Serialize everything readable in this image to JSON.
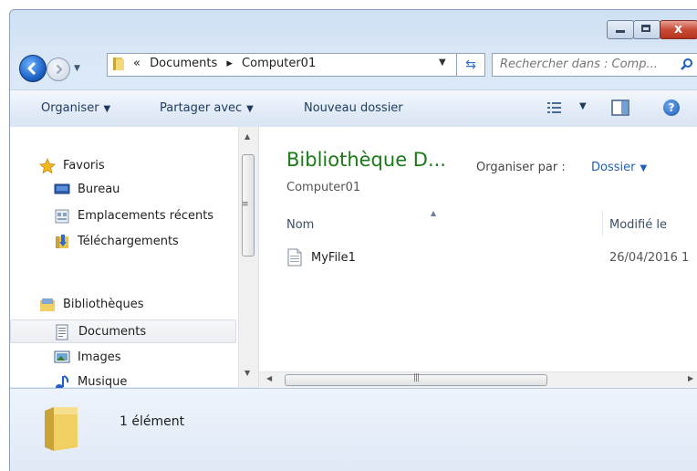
{
  "window": {
    "caption_buttons": {
      "minimize_icon": "minimize-icon",
      "maximize_icon": "maximize-icon",
      "close_icon": "close-icon",
      "close_glyph": "x"
    }
  },
  "navigation": {
    "breadcrumb": {
      "prefix": "«",
      "items": [
        "Documents",
        "Computer01"
      ],
      "separator": "▸"
    },
    "search_placeholder": "Rechercher dans : Comp..."
  },
  "commands": {
    "organize": "Organiser",
    "share": "Partager avec",
    "new_folder": "Nouveau dossier"
  },
  "nav_pane": {
    "favorites_header": "Favoris",
    "favorites": [
      "Bureau",
      "Emplacements récents",
      "Téléchargements"
    ],
    "libraries_header": "Bibliothèques",
    "libraries": [
      "Documents",
      "Images",
      "Musique"
    ],
    "selected": "Documents"
  },
  "content": {
    "library_title": "Bibliothèque D...",
    "library_subtitle": "Computer01",
    "arrange_label": "Organiser par :",
    "arrange_value": "Dossier",
    "columns": {
      "name": "Nom",
      "modified": "Modifié le"
    },
    "files": [
      {
        "name": "MyFile1",
        "modified": "26/04/2016 1"
      }
    ]
  },
  "details_pane": {
    "item_count": "1 élément"
  },
  "colors": {
    "library_title": "#1a7a16",
    "link": "#1e5fb8",
    "close_button": "#c74b37"
  }
}
